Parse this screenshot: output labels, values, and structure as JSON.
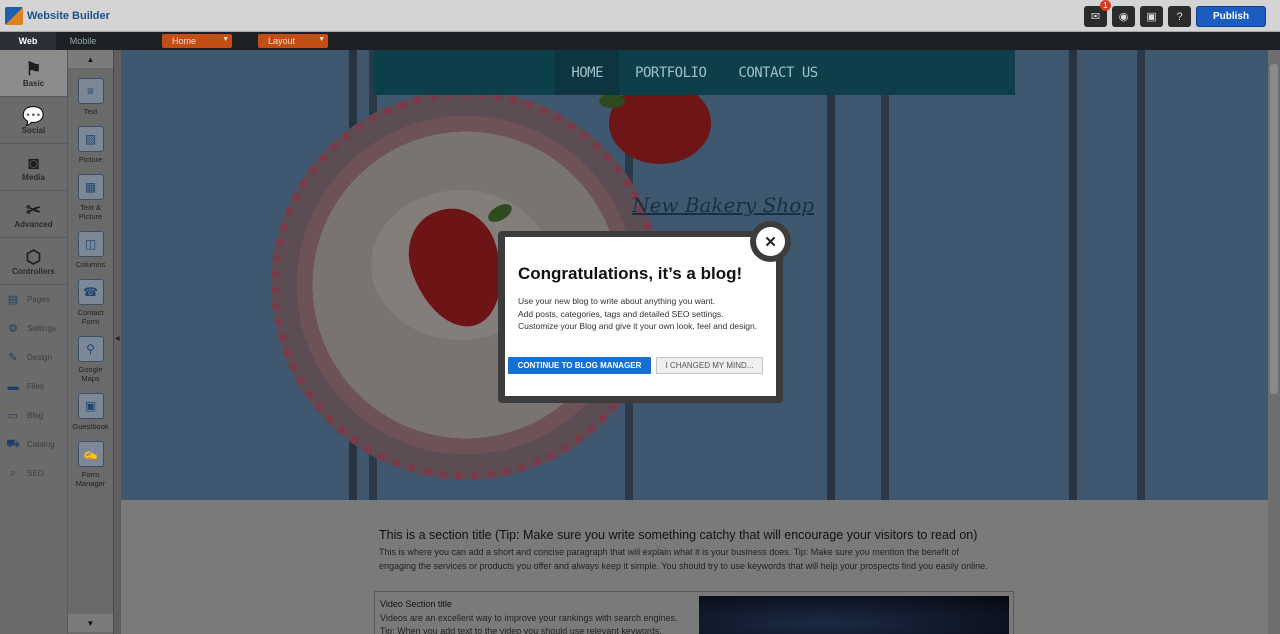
{
  "app": {
    "logo_text": "Website Builder"
  },
  "topbar": {
    "icons": [
      {
        "name": "messages-icon",
        "glyph": "✉",
        "badge": "1"
      },
      {
        "name": "preview-icon",
        "glyph": "◉",
        "badge": ""
      },
      {
        "name": "save-icon",
        "glyph": "▣",
        "badge": ""
      },
      {
        "name": "help-icon",
        "glyph": "?",
        "badge": ""
      }
    ],
    "publish_label": "Publish"
  },
  "modebar": {
    "tabs": [
      {
        "label": "Web",
        "active": true
      },
      {
        "label": "Mobile",
        "active": false
      }
    ],
    "page_dropdown": "Home",
    "layout_dropdown": "Layout"
  },
  "categories": [
    {
      "label": "Basic",
      "icon": "flag-icon",
      "glyph": "⚑",
      "active": true
    },
    {
      "label": "Social",
      "icon": "chat-icon",
      "glyph": "💬",
      "active": false
    },
    {
      "label": "Media",
      "icon": "camera-icon",
      "glyph": "◙",
      "active": false
    },
    {
      "label": "Advanced",
      "icon": "tools-icon",
      "glyph": "✂",
      "active": false
    },
    {
      "label": "Controllers",
      "icon": "box-icon",
      "glyph": "⬡",
      "active": false
    }
  ],
  "subnav": [
    {
      "label": "Pages",
      "icon": "pages-icon",
      "glyph": "▤"
    },
    {
      "label": "Settings",
      "icon": "gear-icon",
      "glyph": "⚙"
    },
    {
      "label": "Design",
      "icon": "brush-icon",
      "glyph": "✎"
    },
    {
      "label": "Files",
      "icon": "folder-icon",
      "glyph": "▬"
    },
    {
      "label": "Blog",
      "icon": "blog-icon",
      "glyph": "▭"
    },
    {
      "label": "Catalog",
      "icon": "cart-icon",
      "glyph": "⛟"
    },
    {
      "label": "SEO",
      "icon": "search-icon",
      "glyph": "⌕"
    }
  ],
  "elements": [
    {
      "label": "Text",
      "icon": "text-icon",
      "glyph": "≡"
    },
    {
      "label": "Picture",
      "icon": "picture-icon",
      "glyph": "▨"
    },
    {
      "label": "Text & Picture",
      "icon": "text-picture-icon",
      "glyph": "▦"
    },
    {
      "label": "Columns",
      "icon": "columns-icon",
      "glyph": "◫"
    },
    {
      "label": "Contact Form",
      "icon": "phone-icon",
      "glyph": "☎"
    },
    {
      "label": "Google Maps",
      "icon": "map-pin-icon",
      "glyph": "⚲"
    },
    {
      "label": "Guestbook",
      "icon": "guestbook-icon",
      "glyph": "▣"
    },
    {
      "label": "Form Manager",
      "icon": "form-icon",
      "glyph": "✍"
    }
  ],
  "site": {
    "nav": [
      {
        "label": "HOME",
        "active": true
      },
      {
        "label": "PORTFOLIO",
        "active": false
      },
      {
        "label": "CONTACT US",
        "active": false
      }
    ],
    "title": "New Bakery Shop",
    "section_title": "This is a section title (Tip: Make sure you write something catchy that will encourage your visitors to read on)",
    "section_text": "This is where you can add a short and concise paragraph that will explain what it is your business does. Tip: Make sure you mention the benefit of engaging the services or products you offer and always keep it simple. You should try to use keywords that will help your prospects find you easily online.",
    "video_title": "Video Section title",
    "video_text": "Videos are an excellent way to improve your rankings with search engines. Tip: When you add text to the video you should use relevant keywords."
  },
  "modal": {
    "title": "Congratulations, it’s a blog!",
    "lines": [
      "Use your new blog to write about anything you want.",
      "Add posts, categories, tags and detailed SEO settings.",
      "Customize your Blog and give it your own look, feel and design."
    ],
    "primary_label": "CONTINUE TO BLOG MANAGER",
    "secondary_label": "I CHANGED MY MIND...",
    "close_glyph": "✕"
  },
  "colors": {
    "accent": "#1670d0",
    "publish": "#1b5dbf",
    "dropdown": "#c44d14"
  }
}
